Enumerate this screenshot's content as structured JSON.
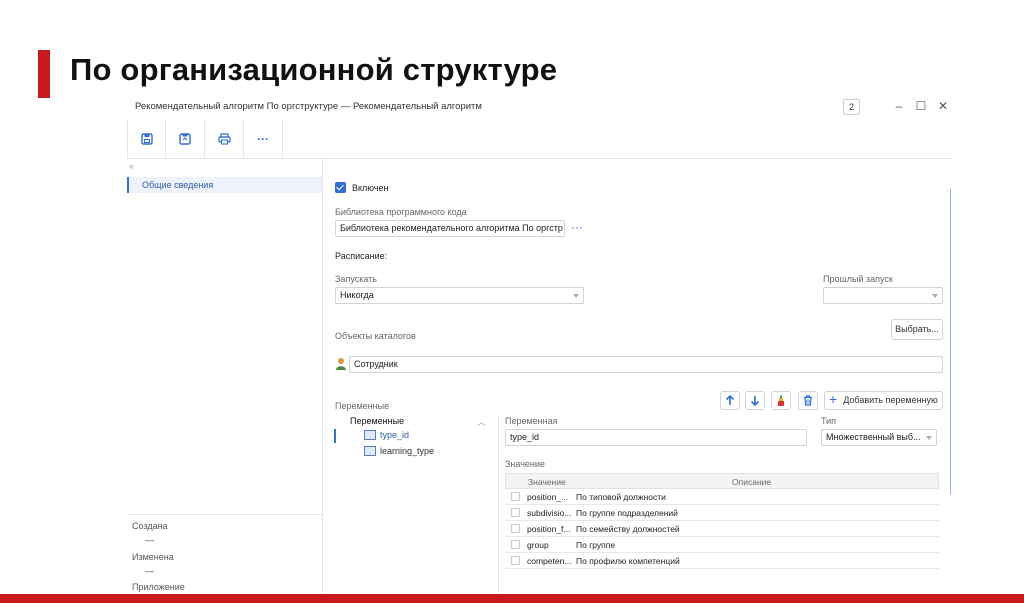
{
  "slide": {
    "title": "По организационной структуре",
    "accent_color": "#c8191c"
  },
  "window": {
    "title": "Рекомендательный алгоритм По оргструктуре — Рекомендательный алгоритм",
    "counter": "2",
    "controls": {
      "minimize": "–",
      "maximize": "☐",
      "close": "✕"
    }
  },
  "toolbar": {
    "buttons": [
      {
        "icon": "save-icon"
      },
      {
        "icon": "save-close-icon"
      },
      {
        "icon": "print-icon"
      },
      {
        "icon": "more-icon",
        "label": "···"
      }
    ]
  },
  "sidebar": {
    "collapse_glyph": "«",
    "items": [
      {
        "label": "Общие сведения",
        "selected": true
      }
    ],
    "footer": {
      "created_label": "Создана",
      "created_value": "—",
      "modified_label": "Изменена",
      "modified_value": "—",
      "attachment_label": "Приложение"
    }
  },
  "form": {
    "enabled_label": "Включен",
    "enabled": true,
    "library_label": "Библиотека программного кода",
    "library_value": "Библиотека рекомендательного алгоритма По оргстр",
    "library_more": "···",
    "schedule_label": "Расписание:",
    "run_label": "Запускать",
    "run_value": "Никогда",
    "last_run_label": "Прошлый запуск",
    "last_run_value": "",
    "catalogs_label": "Объекты каталогов",
    "choose_button": "Выбрать...",
    "catalog_item": "Сотрудник",
    "variables_label": "Переменные",
    "add_variable_button": "Добавить переменную",
    "variables_tree": {
      "root": "Переменные",
      "items": [
        {
          "label": "type_id",
          "selected": true
        },
        {
          "label": "learning_type",
          "selected": false
        }
      ]
    },
    "variable_label": "Переменная",
    "variable_value": "type_id",
    "type_label": "Тип",
    "type_value": "Множественный выб...",
    "value_label": "Значение",
    "grid": {
      "columns": [
        "Значение",
        "Описание"
      ],
      "rows": [
        {
          "value": "position_...",
          "description": "По типовой должности"
        },
        {
          "value": "subdivisio...",
          "description": "По группе подразделений"
        },
        {
          "value": "position_f...",
          "description": "По семейству должностей"
        },
        {
          "value": "group",
          "description": "По группе"
        },
        {
          "value": "competen...",
          "description": "По профилю компетенций"
        }
      ]
    }
  }
}
